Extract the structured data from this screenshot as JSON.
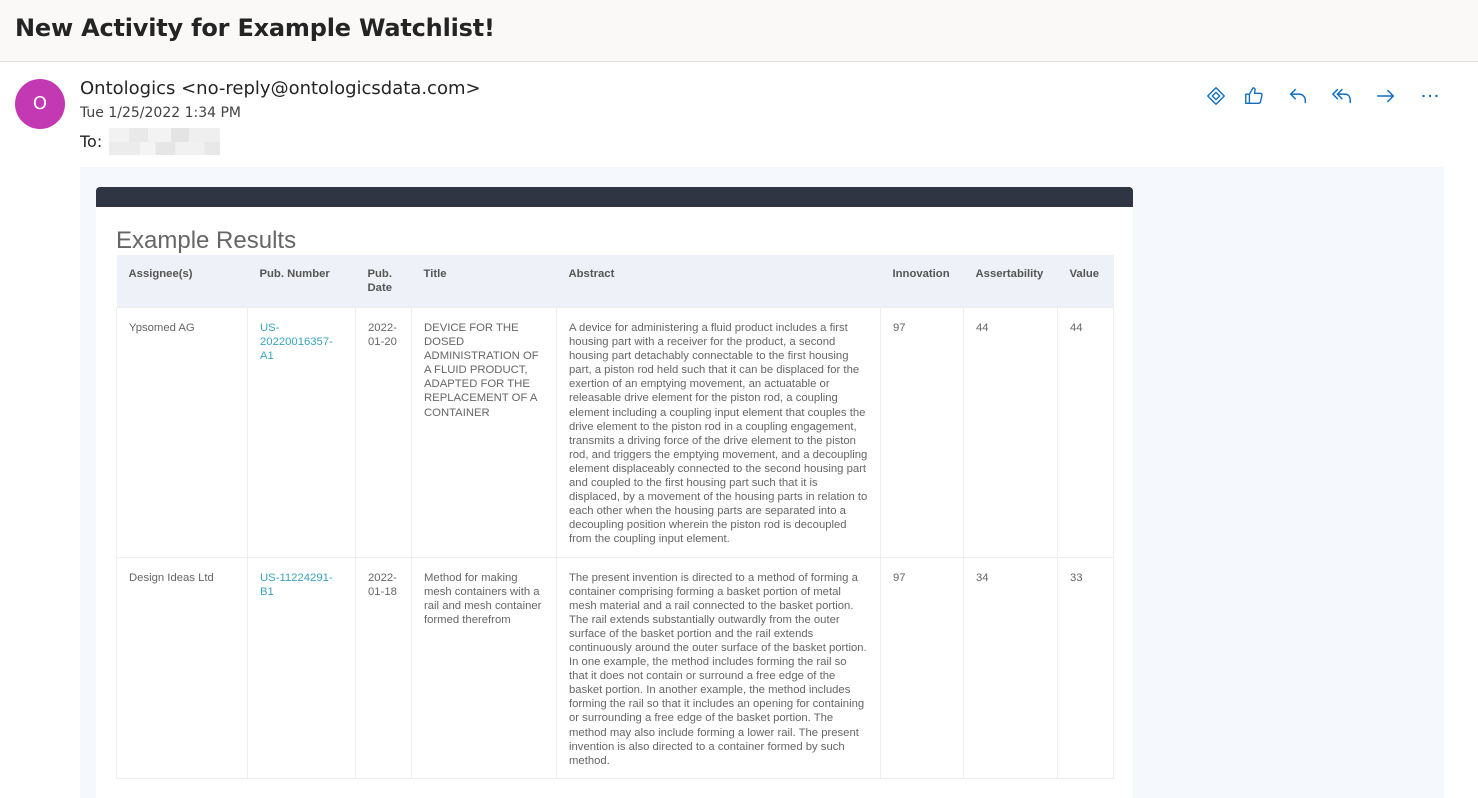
{
  "subject": "New Activity for Example Watchlist!",
  "message": {
    "avatar_initial": "O",
    "sender": "Ontologics <no-reply@ontologicsdata.com>",
    "date": "Tue 1/25/2022 1:34 PM",
    "to_label": "To:"
  },
  "actions": [
    {
      "name": "immersive-reader-icon"
    },
    {
      "name": "like-icon"
    },
    {
      "name": "reply-icon"
    },
    {
      "name": "reply-all-icon"
    },
    {
      "name": "forward-icon"
    },
    {
      "name": "more-options-icon"
    }
  ],
  "colors": {
    "avatar": "#c239b3",
    "action_icon": "#0f6cbd",
    "card_header": "#2f3542",
    "link": "#3aa3bd"
  },
  "results": {
    "title": "Example Results",
    "columns": [
      "Assignee(s)",
      "Pub. Number",
      "Pub. Date",
      "Title",
      "Abstract",
      "Innovation",
      "Assertability",
      "Value"
    ],
    "rows": [
      {
        "assignee": "Ypsomed AG",
        "pub_number": "US-20220016357-A1",
        "pub_date": "2022-01-20",
        "title": "DEVICE FOR THE DOSED ADMINISTRATION OF A FLUID PRODUCT, ADAPTED FOR THE REPLACEMENT OF A CONTAINER",
        "abstract": "A device for administering a fluid product includes a first housing part with a receiver for the product, a second housing part detachably connectable to the first housing part, a piston rod held such that it can be displaced for the exertion of an emptying movement, an actuatable or releasable drive element for the piston rod, a coupling element including a coupling input element that couples the drive element to the piston rod in a coupling engagement, transmits a driving force of the drive element to the piston rod, and triggers the emptying movement, and a decoupling element displaceably connected to the second housing part and coupled to the first housing part such that it is displaced, by a movement of the housing parts in relation to each other when the housing parts are separated into a decoupling position wherein the piston rod is decoupled from the coupling input element.",
        "innovation": "97",
        "assertability": "44",
        "value": "44"
      },
      {
        "assignee": "Design Ideas Ltd",
        "pub_number": "US-11224291-B1",
        "pub_date": "2022-01-18",
        "title": "Method for making mesh containers with a rail and mesh container formed therefrom",
        "abstract": "The present invention is directed to a method of forming a container comprising forming a basket portion of metal mesh material and a rail connected to the basket portion. The rail extends substantially outwardly from the outer surface of the basket portion and the rail extends continuously around the outer surface of the basket portion. In one example, the method includes forming the rail so that it does not contain or surround a free edge of the basket portion. In another example, the method includes forming the rail so that it includes an opening for containing or surrounding a free edge of the basket portion. The method may also include forming a lower rail. The present invention is also directed to a container formed by such method.",
        "innovation": "97",
        "assertability": "34",
        "value": "33"
      }
    ]
  }
}
